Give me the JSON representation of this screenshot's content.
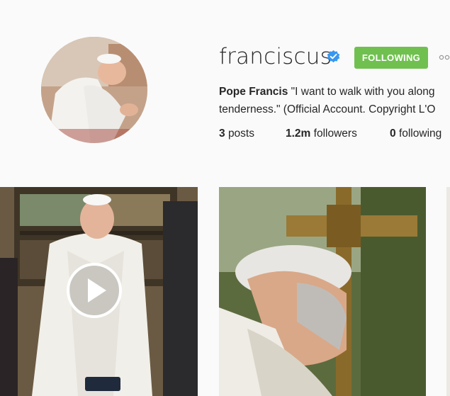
{
  "profile": {
    "username": "franciscus",
    "verified": true,
    "follow_button_label": "FOLLOWING",
    "bio_name": "Pope Francis",
    "bio_line1_rest": " \"I want to walk with you along",
    "bio_line2": "tenderness.\" (Official Account. Copyright L'O"
  },
  "stats": {
    "posts_count": "3",
    "posts_label": "posts",
    "followers_count": "1.2m",
    "followers_label": "followers",
    "following_count": "0",
    "following_label": "following"
  },
  "colors": {
    "following_button": "#70c050",
    "verified_badge": "#3897f0",
    "text": "#262626",
    "background": "#fafafa"
  },
  "icons": {
    "verified": "verified-badge-icon",
    "more": "more-options-icon",
    "play": "play-icon"
  }
}
